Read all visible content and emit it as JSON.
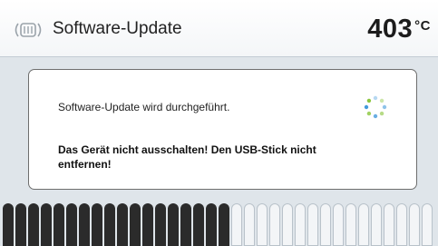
{
  "header": {
    "title": "Software-Update",
    "temperature": "403",
    "unit": "°C",
    "icon": "oven-icon"
  },
  "dialog": {
    "message": "Software-Update wird durchgeführt.",
    "warning": "Das Gerät nicht ausschalten! Den USB-Stick nicht entfernen!",
    "spinner_icon": "loading-spinner-icon",
    "spinner_colors": [
      "#2f8fd8",
      "#8cc63f",
      "#2f8fd8",
      "#8cc63f",
      "#2f8fd8",
      "#8cc63f",
      "#2f8fd8",
      "#8cc63f"
    ]
  },
  "progress": {
    "fraction": 0.53,
    "filled_color": "#2b2b2b",
    "empty_color": "#f3f5f7"
  }
}
